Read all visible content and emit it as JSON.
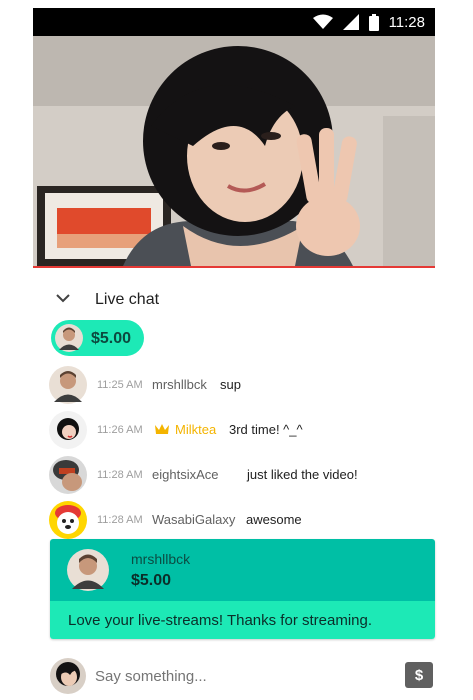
{
  "status_bar": {
    "time": "11:28",
    "icons": [
      "wifi-icon",
      "cellular-signal-icon",
      "battery-icon"
    ]
  },
  "video": {
    "description_icon": "live-video-frame"
  },
  "chat": {
    "title": "Live chat",
    "ticker": {
      "amount": "$5.00"
    },
    "messages": [
      {
        "time": "11:25 AM",
        "author": "mrshllbck",
        "text": "sup",
        "author_color": "#616161",
        "badge": null
      },
      {
        "time": "11:26 AM",
        "author": "Milktea",
        "text": "3rd time! ^_^",
        "author_color": "#f4b400",
        "badge": "crown-icon"
      },
      {
        "time": "11:28 AM",
        "author": "eightsixAce",
        "text": "just liked the video!",
        "author_color": "#616161",
        "badge": null
      },
      {
        "time": "11:28 AM",
        "author": "WasabiGalaxy",
        "text": "awesome",
        "author_color": "#616161",
        "badge": null
      }
    ],
    "superchat": {
      "author": "mrshllbck",
      "amount": "$5.00",
      "message": "Love your live-streams! Thanks for streaming.",
      "header_color": "#00bfa5",
      "body_color": "#1de9b6"
    }
  },
  "input": {
    "placeholder": "Say something...",
    "action_icon": "dollar-icon"
  },
  "colors": {
    "accent_red": "#e53935",
    "ticker_green": "#1de9b6",
    "gold": "#f4b400"
  }
}
